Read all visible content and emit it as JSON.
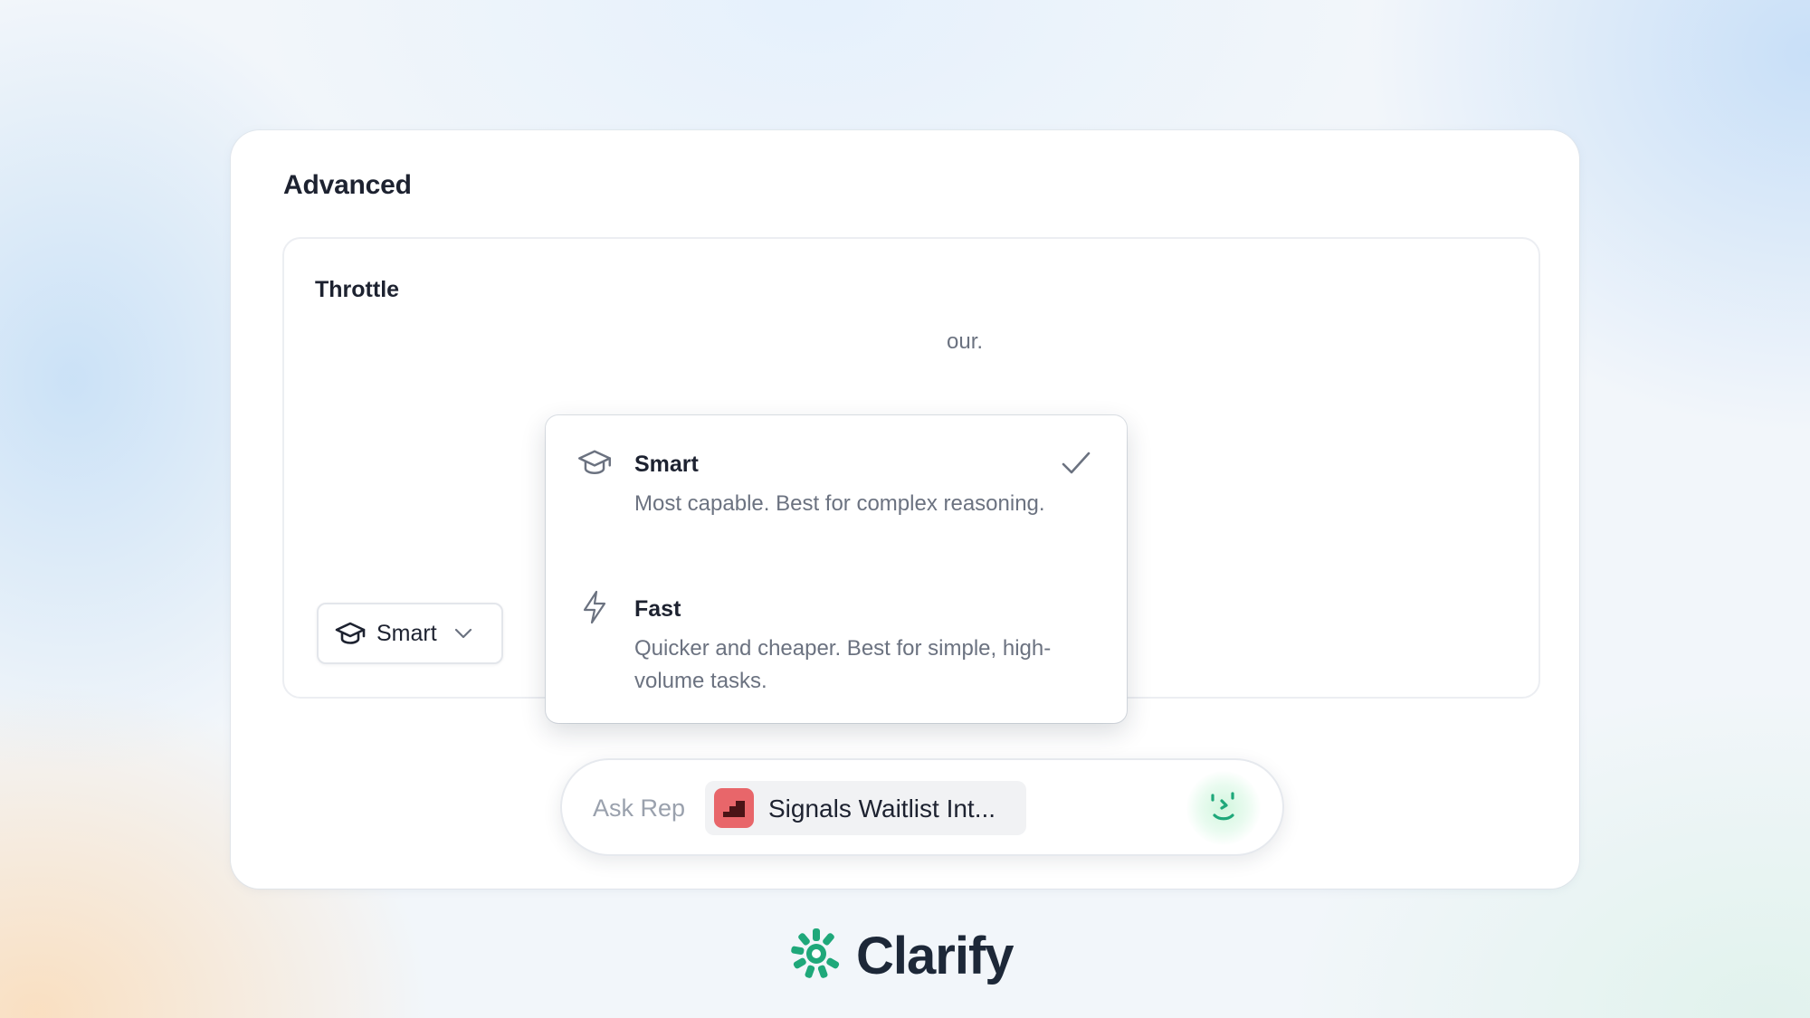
{
  "card": {
    "title": "Advanced"
  },
  "panel": {
    "label": "Throttle",
    "description": "our."
  },
  "model_select": {
    "selected_label": "Smart",
    "selected_icon": "graduation-cap-icon"
  },
  "dropdown": {
    "options": [
      {
        "title": "Smart",
        "description": "Most capable. Best for complex reasoning.",
        "icon": "graduation-cap-icon",
        "selected": true
      },
      {
        "title": "Fast",
        "description": "Quicker and cheaper. Best for simple, high-volume tasks.",
        "icon": "lightning-bolt-icon",
        "selected": false
      }
    ]
  },
  "chat": {
    "ask_label": "Ask Rep",
    "context_chip_label": "Signals Waitlist Int...",
    "context_chip_color": "#e8666a"
  },
  "brand": {
    "name": "Clarify",
    "logo_color": "#1fa87a"
  },
  "colors": {
    "text_primary": "#1d2230",
    "text_secondary": "#6b7280",
    "accent_green": "#1fa87a"
  }
}
